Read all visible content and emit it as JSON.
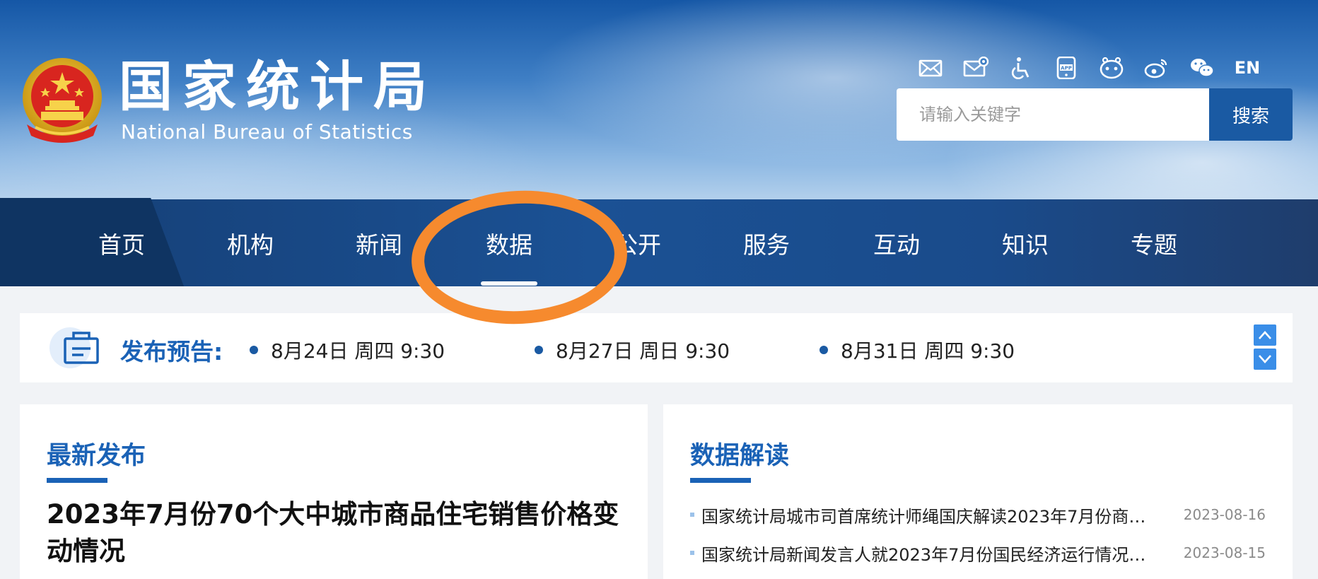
{
  "header": {
    "logo_cn": "国家统计局",
    "logo_en": "National Bureau of Statistics",
    "tools": [
      {
        "icon": "mail-icon",
        "label": "Email"
      },
      {
        "icon": "mail-settings-icon",
        "label": "Email settings"
      },
      {
        "icon": "accessibility-icon",
        "label": "Accessibility"
      },
      {
        "icon": "app-icon",
        "label": "APP"
      },
      {
        "icon": "mini-program-icon",
        "label": "Mini program"
      },
      {
        "icon": "weibo-icon",
        "label": "Weibo"
      },
      {
        "icon": "wechat-icon",
        "label": "WeChat"
      }
    ],
    "en_label": "EN",
    "search": {
      "placeholder": "请输入关键字",
      "value": "",
      "button": "搜索"
    }
  },
  "nav": {
    "items": [
      "首页",
      "机构",
      "新闻",
      "数据",
      "公开",
      "服务",
      "互动",
      "知识",
      "专题"
    ],
    "active": "数据"
  },
  "notice": {
    "title": "发布预告:",
    "items": [
      "8月24日 周四 9:30",
      "8月27日 周日 9:30",
      "8月31日 周四 9:30"
    ]
  },
  "latest": {
    "title": "最新发布",
    "headline": "2023年7月份70个大中城市商品住宅销售价格变动情况"
  },
  "interpretation": {
    "title": "数据解读",
    "items": [
      {
        "text": "国家统计局城市司首席统计师绳国庆解读2023年7月份商品...",
        "date": "2023-08-16"
      },
      {
        "text": "国家统计局新闻发言人就2023年7月份国民经济运行情况答...",
        "date": "2023-08-15"
      }
    ]
  },
  "colors": {
    "brand_blue": "#1a62b6",
    "nav_blue": "#1b5194",
    "annotation_orange": "#f68a2e"
  }
}
